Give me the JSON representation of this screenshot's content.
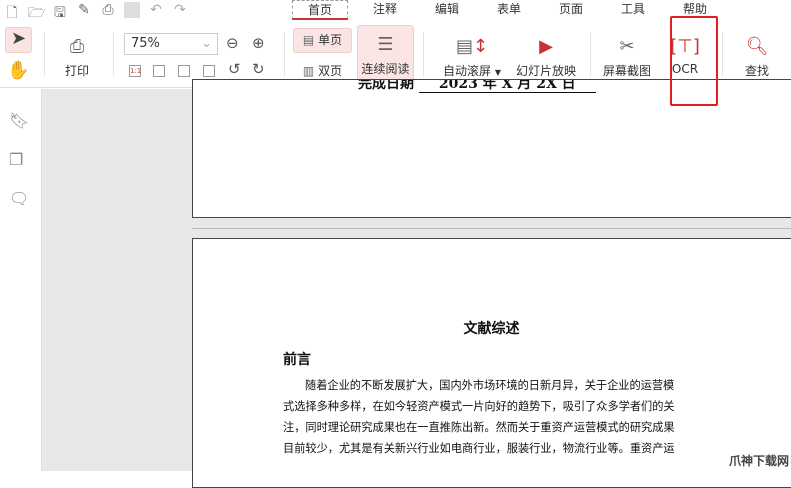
{
  "quick_access": {
    "icons": [
      "new-file-icon",
      "open-folder-icon",
      "save-icon",
      "save-as-icon",
      "print-icon",
      "undo-icon",
      "redo-icon"
    ]
  },
  "menu": {
    "tabs": [
      "首页",
      "注释",
      "编辑",
      "表单",
      "页面",
      "工具",
      "帮助"
    ],
    "active": "首页"
  },
  "toolbar": {
    "print": "打印",
    "zoom_value": "75%",
    "single_page": "单页",
    "double_page": "双页",
    "continuous": "连续阅读",
    "auto_scroll": "自动滚屏",
    "slideshow": "幻灯片放映",
    "screenshot": "屏幕截图",
    "ocr": "OCR",
    "find": "查找"
  },
  "page1": {
    "label": "完成日期",
    "value": "2023 年 X 月 2X 日"
  },
  "page2": {
    "title": "文献综述",
    "heading": "前言",
    "lines": [
      "随着企业的不断发展扩大，国内外市场环境的日新月异，关于企业的运营模",
      "式选择多种多样，在如今轻资产模式一片向好的趋势下，吸引了众多学者们的关",
      "注，同时理论研究成果也在一直推陈出新。然而关于重资产运营模式的研究成果",
      "目前较少，尤其是有关新兴行业如电商行业，服装行业，物流行业等。重资产运"
    ]
  },
  "watermark": "爪神下载网",
  "colors": {
    "accent": "#c83232",
    "highlight": "#fbe4e4",
    "ocr_box": "#e02020"
  }
}
